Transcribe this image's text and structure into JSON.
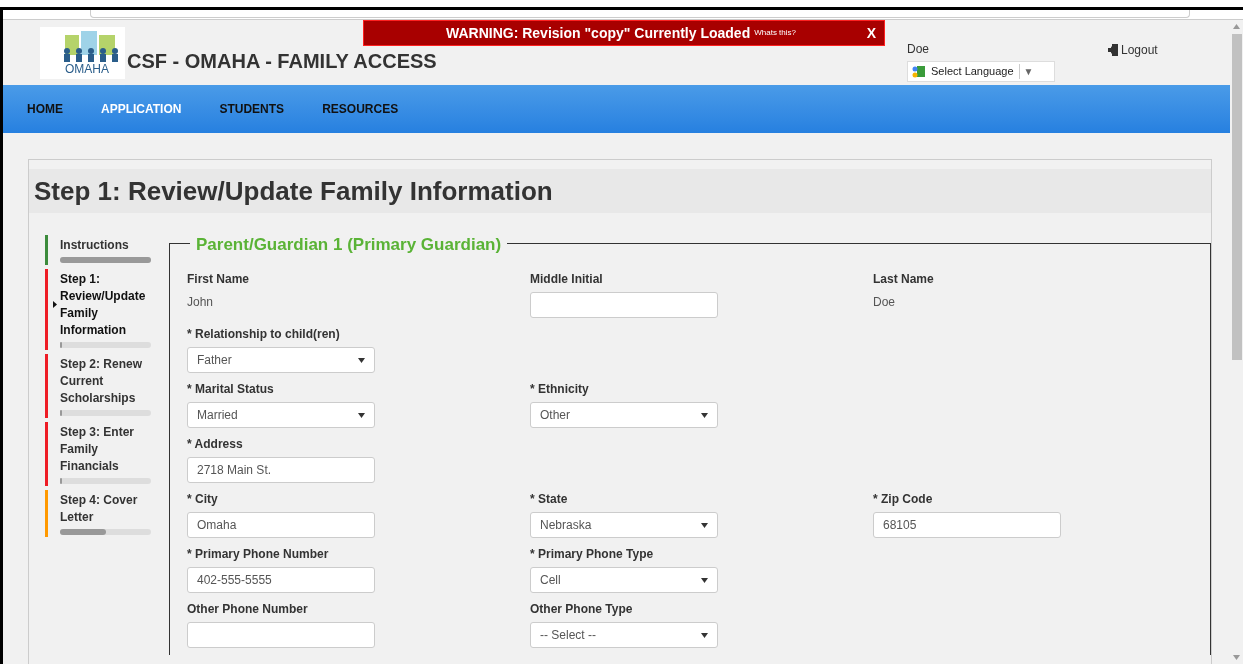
{
  "banner": {
    "warning": "WARNING: Revision \"copy\" Currently Loaded",
    "link": "Whats this?",
    "close": "X"
  },
  "header": {
    "logo_text": "OMAHA",
    "title": "CSF - OMAHA - FAMILY ACCESS",
    "user": "Doe",
    "language": "Select Language",
    "language_caret": "▼",
    "logout": "Logout"
  },
  "nav": [
    {
      "label": "HOME",
      "selected": false
    },
    {
      "label": "APPLICATION",
      "selected": true
    },
    {
      "label": "STUDENTS",
      "selected": false
    },
    {
      "label": "RESOURCES",
      "selected": false
    }
  ],
  "page_title": "Step 1: Review/Update Family Information",
  "steps": [
    {
      "label": "Instructions",
      "color": "#3c8b3c",
      "selected": false,
      "level": 1
    },
    {
      "label": "Step 1: Review/Update Family Information",
      "color": "#ee1c25",
      "selected": true,
      "level": 0
    },
    {
      "label": "Step 2: Renew Current Scholarships",
      "color": "#ee1c25",
      "selected": false,
      "level": 0
    },
    {
      "label": "Step 3: Enter Family Financials",
      "color": "#ee1c25",
      "selected": false,
      "level": 0
    },
    {
      "label": "Step 4: Cover Letter",
      "color": "#ff9900",
      "selected": false,
      "level": 0.5
    }
  ],
  "section_title": "Parent/Guardian 1 (Primary Guardian)",
  "rows": [
    [
      {
        "kind": "static",
        "label": "First Name",
        "value": "John"
      },
      {
        "kind": "input",
        "label": "Middle Initial"
      },
      {
        "kind": "static",
        "label": "Last Name",
        "value": "Doe"
      }
    ],
    [
      {
        "kind": "select",
        "label": "* Relationship to child(ren)",
        "value": "Father"
      },
      null,
      null
    ],
    [
      {
        "kind": "select",
        "label": "* Marital Status",
        "value": "Married"
      },
      {
        "kind": "select",
        "label": "* Ethnicity",
        "value": "Other"
      },
      null
    ],
    [
      {
        "kind": "input",
        "label": "* Address",
        "value": "2718 Main St."
      },
      null,
      null
    ],
    [
      {
        "kind": "input",
        "label": "* City",
        "value": "Omaha"
      },
      {
        "kind": "select",
        "label": "* State",
        "value": "Nebraska"
      },
      {
        "kind": "input",
        "label": "* Zip Code",
        "value": "68105"
      }
    ],
    [
      {
        "kind": "input",
        "label": "* Primary Phone Number",
        "value": "402-555-5555"
      },
      {
        "kind": "select",
        "label": "* Primary Phone Type",
        "value": "Cell"
      },
      null
    ],
    [
      {
        "kind": "input",
        "label": "Other Phone Number"
      },
      {
        "kind": "select",
        "label": "Other Phone Type",
        "value": "-- Select --"
      },
      null
    ]
  ]
}
